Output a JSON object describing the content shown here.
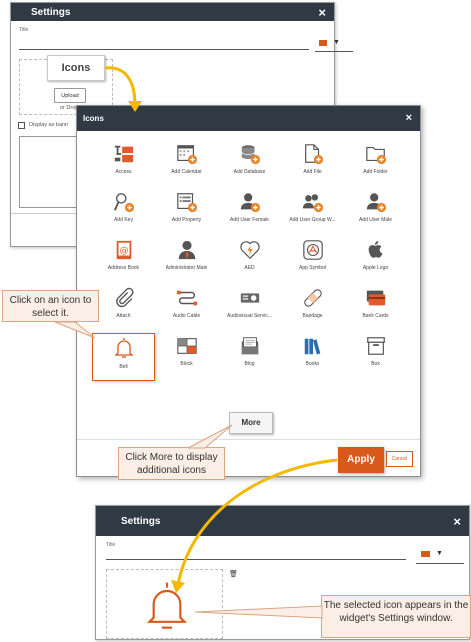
{
  "settings_top": {
    "title": "Settings",
    "title_field_label": "Title",
    "upload_label": "Upload",
    "drop_text": "or Drop",
    "display_as_banner": "Display as bann"
  },
  "icons_label": "Icons",
  "icons_dialog": {
    "title": "Icons",
    "icons": [
      {
        "label": "Access",
        "icon": "access-icon"
      },
      {
        "label": "Add Calendar",
        "icon": "add-calendar-icon"
      },
      {
        "label": "Add Database",
        "icon": "add-database-icon"
      },
      {
        "label": "Add File",
        "icon": "add-file-icon"
      },
      {
        "label": "Add Folder",
        "icon": "add-folder-icon"
      },
      {
        "label": "Add Key",
        "icon": "add-key-icon"
      },
      {
        "label": "Add Property",
        "icon": "add-property-icon"
      },
      {
        "label": "Add User Female",
        "icon": "add-user-female-icon"
      },
      {
        "label": "Add User Group W...",
        "icon": "add-user-group-icon"
      },
      {
        "label": "Add User Male",
        "icon": "add-user-male-icon"
      },
      {
        "label": "Address Book",
        "icon": "address-book-icon"
      },
      {
        "label": "Administrator Male",
        "icon": "administrator-male-icon"
      },
      {
        "label": "AED",
        "icon": "aed-icon"
      },
      {
        "label": "App Symbol",
        "icon": "app-symbol-icon"
      },
      {
        "label": "Apple Logo",
        "icon": "apple-logo-icon"
      },
      {
        "label": "Attach",
        "icon": "attach-icon"
      },
      {
        "label": "Audio Cable",
        "icon": "audio-cable-icon"
      },
      {
        "label": "Audiovisual Servic...",
        "icon": "audiovisual-icon"
      },
      {
        "label": "Bandage",
        "icon": "bandage-icon"
      },
      {
        "label": "Bank Cards",
        "icon": "bank-cards-icon"
      },
      {
        "label": "Bell",
        "icon": "bell-icon",
        "selected": true
      },
      {
        "label": "Block",
        "icon": "block-icon"
      },
      {
        "label": "Blog",
        "icon": "blog-icon"
      },
      {
        "label": "Books",
        "icon": "books-icon"
      },
      {
        "label": "Box",
        "icon": "box-icon"
      }
    ],
    "more_label": "More",
    "apply_label": "Apply",
    "cancel_label": "Cancel"
  },
  "callouts": {
    "select_icon": "Click on an icon to select it.",
    "more_icons": "Click More to display additional icons",
    "selected_icon": "The selected icon appears in the widget's Settings window."
  },
  "settings_bottom": {
    "title": "Settings",
    "title_field_label": "Title"
  },
  "colors": {
    "accent": "#d9591a",
    "header": "#2f3a45",
    "callout_bg": "#fbeee6",
    "arrow": "#f5b800"
  }
}
